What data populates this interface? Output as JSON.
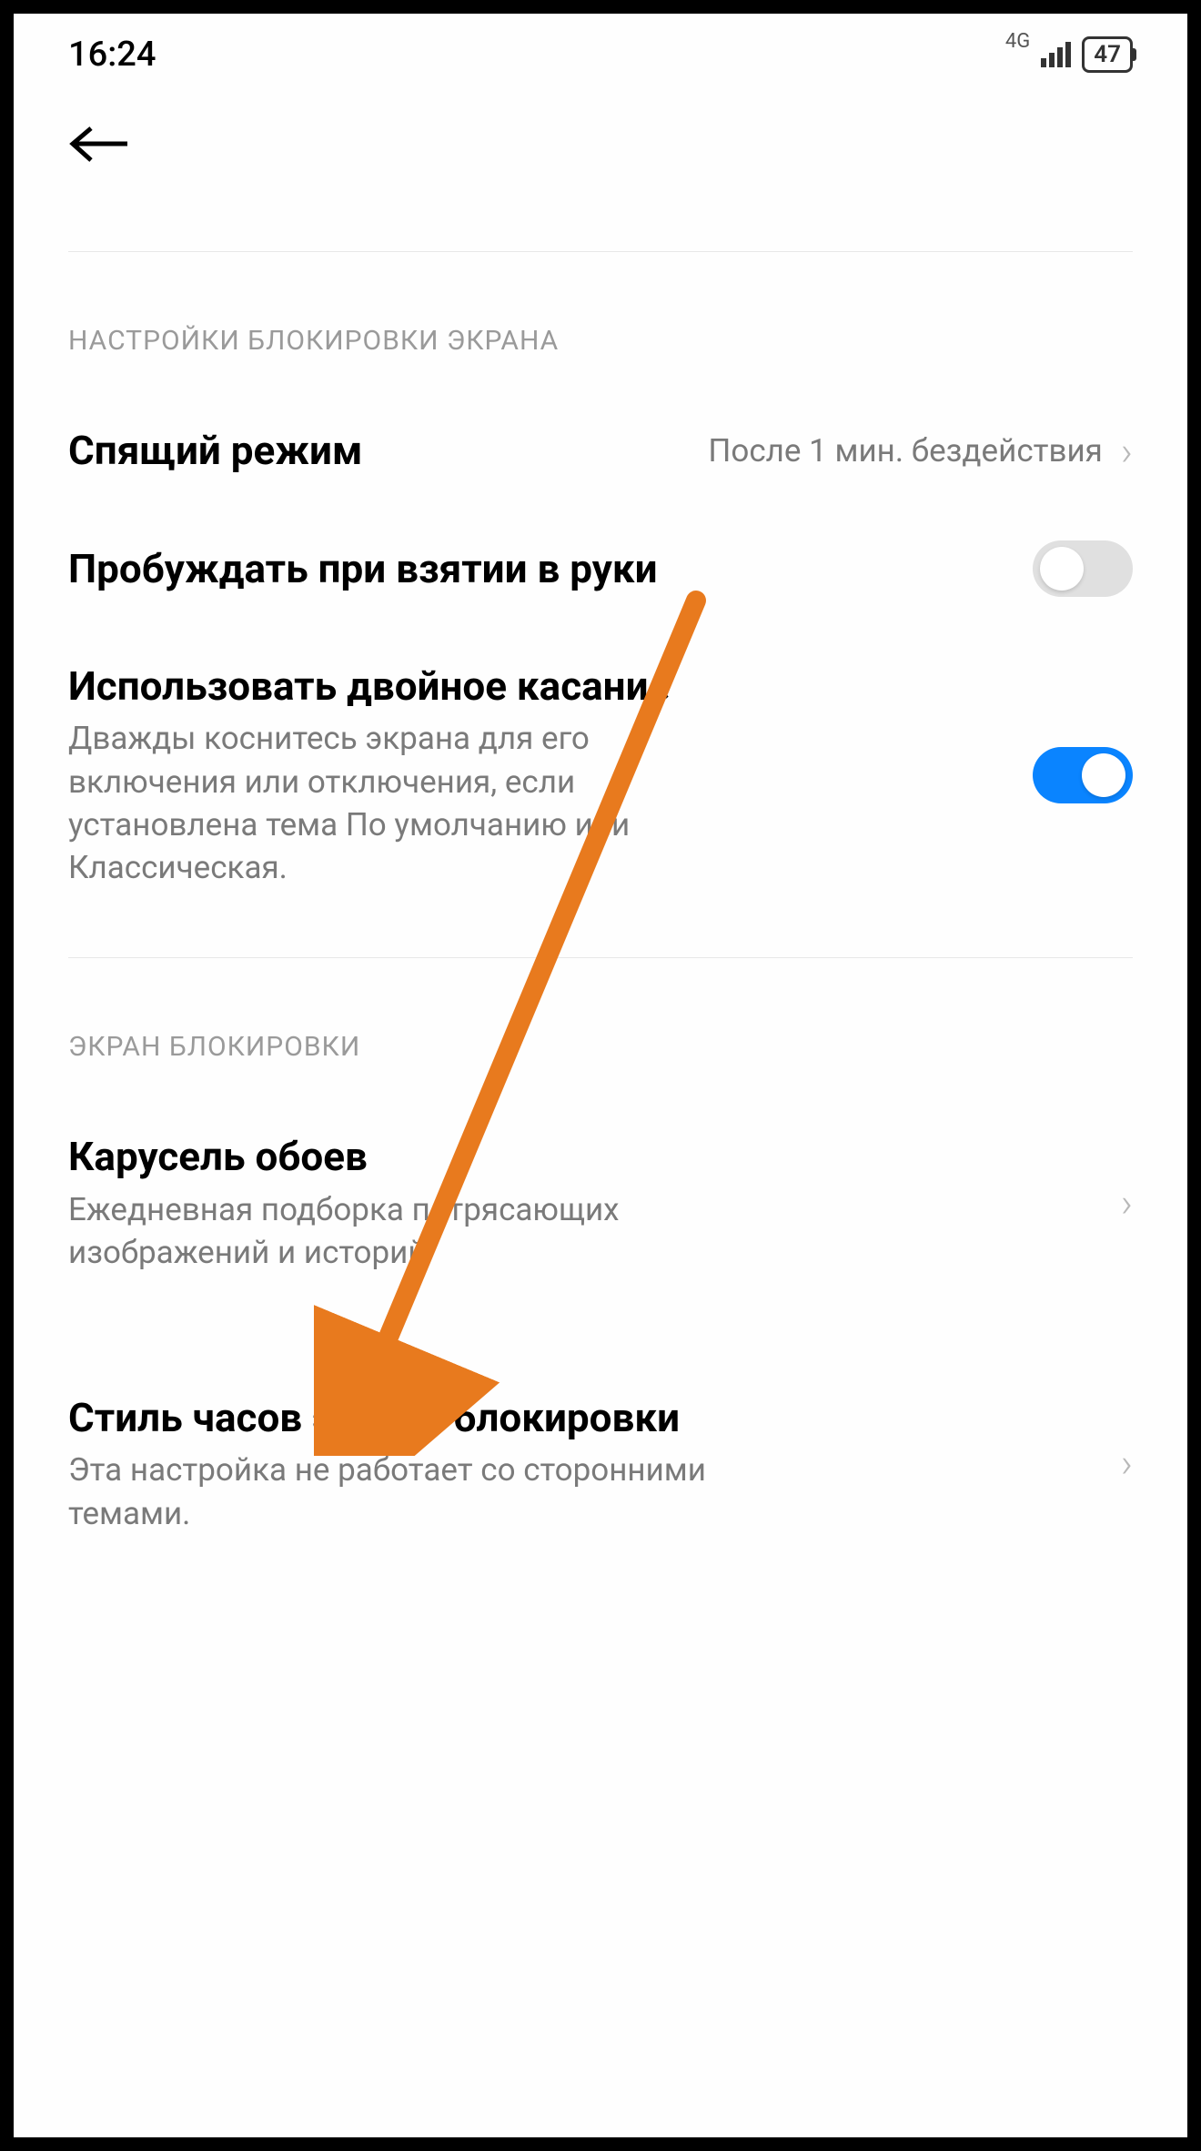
{
  "status": {
    "time": "16:24",
    "network": "4G",
    "battery": "47"
  },
  "sections": {
    "lockSettings": {
      "header": "НАСТРОЙКИ БЛОКИРОВКИ ЭКРАНА",
      "sleep": {
        "title": "Спящий режим",
        "value": "После 1 мин. бездействия"
      },
      "wakeOnPickup": {
        "title": "Пробуждать при взятии в руки"
      },
      "doubleTap": {
        "title": "Использовать двойное касание",
        "subtitle": "Дважды коснитесь экрана для его включения или отключения, если установлена тема По умолчанию или Классическая."
      }
    },
    "lockScreen": {
      "header": "ЭКРАН БЛОКИРОВКИ",
      "carousel": {
        "title": "Карусель обоев",
        "subtitle": "Ежедневная подборка потрясающих изображений и историй"
      },
      "clockStyle": {
        "title": "Стиль часов экрана блокировки",
        "subtitle": "Эта настройка не работает со сторонними темами."
      }
    }
  },
  "annotation": {
    "color": "#e87a1e"
  }
}
